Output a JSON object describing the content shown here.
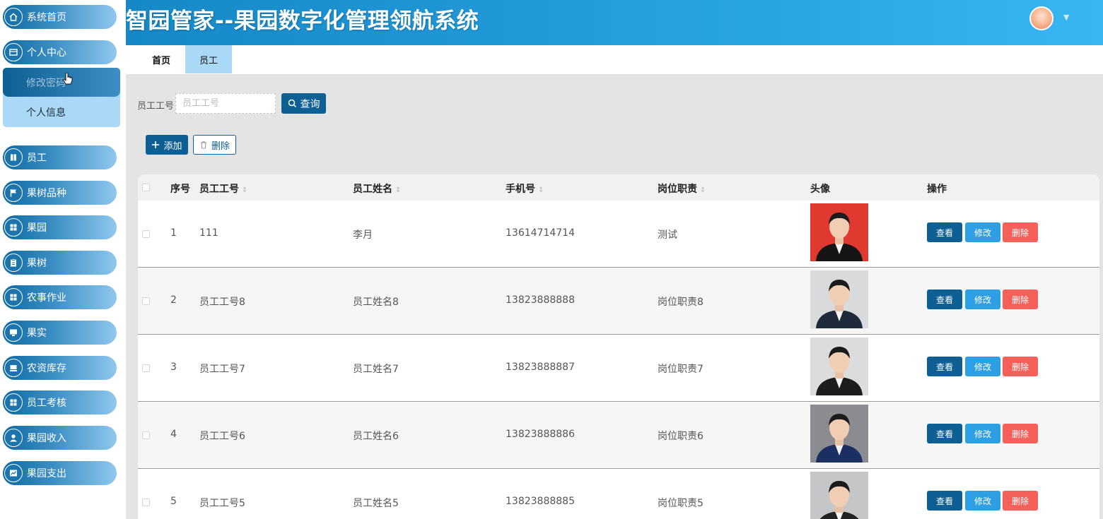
{
  "app": {
    "title": "智园管家--果园数字化管理领航系统"
  },
  "sidebar": {
    "items": [
      {
        "label": "系统首页",
        "icon": "home-icon"
      },
      {
        "label": "个人中心",
        "icon": "profile-card-icon"
      },
      {
        "label": "员工",
        "icon": "book-icon"
      },
      {
        "label": "果树品种",
        "icon": "flag-icon"
      },
      {
        "label": "果园",
        "icon": "grid-icon"
      },
      {
        "label": "果树",
        "icon": "clipboard-icon"
      },
      {
        "label": "农事作业",
        "icon": "grid-icon"
      },
      {
        "label": "果实",
        "icon": "monitor-icon"
      },
      {
        "label": "农资库存",
        "icon": "tray-icon"
      },
      {
        "label": "员工考核",
        "icon": "grid-icon"
      },
      {
        "label": "果园收入",
        "icon": "user-icon"
      },
      {
        "label": "果园支出",
        "icon": "chart-icon"
      }
    ],
    "submenu": [
      {
        "label": "修改密码"
      },
      {
        "label": "个人信息"
      }
    ]
  },
  "tabs": [
    {
      "label": "首页"
    },
    {
      "label": "员工"
    }
  ],
  "search": {
    "label": "员工工号",
    "placeholder": "员工工号",
    "value": "",
    "button_label": "查询"
  },
  "actions": {
    "add_label": "添加",
    "delete_label": "删除"
  },
  "table": {
    "headers": {
      "index": "序号",
      "emp_no": "员工工号",
      "emp_name": "员工姓名",
      "phone": "手机号",
      "duty": "岗位职责",
      "photo": "头像",
      "ops": "操作"
    },
    "row_buttons": {
      "view": "查看",
      "edit": "修改",
      "delete": "删除"
    },
    "rows": [
      {
        "index": "1",
        "emp_no": "111",
        "emp_name": "李月",
        "phone": "13614714714",
        "duty": "测试",
        "photo_bg": "#e0392f",
        "suit": "#151515"
      },
      {
        "index": "2",
        "emp_no": "员工工号8",
        "emp_name": "员工姓名8",
        "phone": "13823888888",
        "duty": "岗位职责8",
        "photo_bg": "#d9dadc",
        "suit": "#1f2a3d"
      },
      {
        "index": "3",
        "emp_no": "员工工号7",
        "emp_name": "员工姓名7",
        "phone": "13823888887",
        "duty": "岗位职责7",
        "photo_bg": "#dcdcdc",
        "suit": "#1d1d1d"
      },
      {
        "index": "4",
        "emp_no": "员工工号6",
        "emp_name": "员工姓名6",
        "phone": "13823888886",
        "duty": "岗位职责6",
        "photo_bg": "#8a8c90",
        "suit": "#1b2f63"
      },
      {
        "index": "5",
        "emp_no": "员工工号5",
        "emp_name": "员工姓名5",
        "phone": "13823888885",
        "duty": "岗位职责5",
        "photo_bg": "#c5c6c8",
        "suit": "#222222"
      }
    ]
  },
  "colors": {
    "primary": "#0e5f93",
    "edit": "#2f9fe3",
    "danger": "#f5605a",
    "header": "#2aa6e4",
    "active_tab": "#a9d9f7"
  }
}
